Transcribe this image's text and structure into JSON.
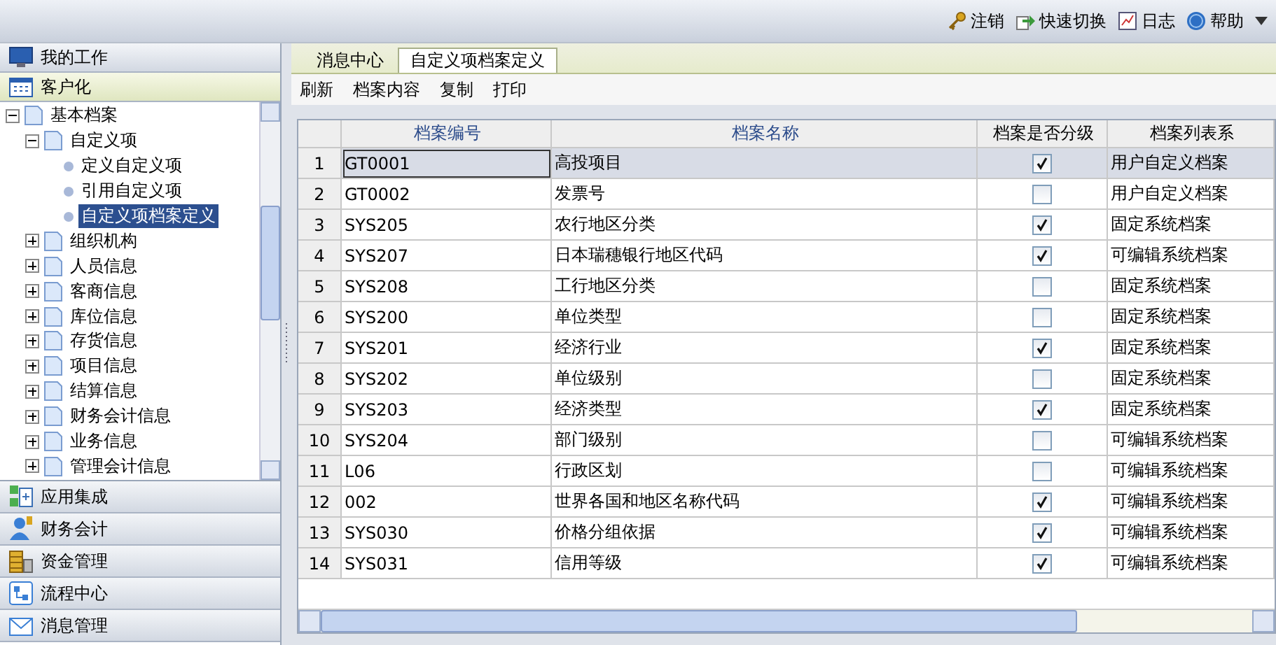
{
  "top_bar": {
    "actions": [
      {
        "label": "注销"
      },
      {
        "label": "快速切换"
      },
      {
        "label": "日志"
      },
      {
        "label": "帮助"
      }
    ]
  },
  "sections": [
    {
      "label": "我的工作",
      "selected": false
    },
    {
      "label": "客户化",
      "selected": true
    },
    {
      "label": "应用集成",
      "selected": false
    },
    {
      "label": "财务会计",
      "selected": false
    },
    {
      "label": "资金管理",
      "selected": false
    },
    {
      "label": "流程中心",
      "selected": false
    },
    {
      "label": "消息管理",
      "selected": false
    }
  ],
  "tree": [
    {
      "label": "基本档案",
      "kind": "folder",
      "expanded": true,
      "selected": false,
      "children": [
        {
          "label": "自定义项",
          "kind": "folder",
          "expanded": true,
          "selected": false,
          "children": [
            {
              "label": "定义自定义项",
              "kind": "leaf",
              "selected": false
            },
            {
              "label": "引用自定义项",
              "kind": "leaf",
              "selected": false
            },
            {
              "label": "自定义项档案定义",
              "kind": "leaf",
              "selected": true
            }
          ]
        },
        {
          "label": "组织机构",
          "kind": "folder",
          "expanded": false,
          "selected": false
        },
        {
          "label": "人员信息",
          "kind": "folder",
          "expanded": false,
          "selected": false
        },
        {
          "label": "客商信息",
          "kind": "folder",
          "expanded": false,
          "selected": false
        },
        {
          "label": "库位信息",
          "kind": "folder",
          "expanded": false,
          "selected": false
        },
        {
          "label": "存货信息",
          "kind": "folder",
          "expanded": false,
          "selected": false
        },
        {
          "label": "项目信息",
          "kind": "folder",
          "expanded": false,
          "selected": false
        },
        {
          "label": "结算信息",
          "kind": "folder",
          "expanded": false,
          "selected": false
        },
        {
          "label": "财务会计信息",
          "kind": "folder",
          "expanded": false,
          "selected": false
        },
        {
          "label": "业务信息",
          "kind": "folder",
          "expanded": false,
          "selected": false
        },
        {
          "label": "管理会计信息",
          "kind": "folder",
          "expanded": false,
          "selected": false
        }
      ]
    }
  ],
  "tabs": [
    {
      "label": "消息中心",
      "selected": false
    },
    {
      "label": "自定义项档案定义",
      "selected": true
    }
  ],
  "toolbar": [
    "刷新",
    "档案内容",
    "复制",
    "打印"
  ],
  "table": {
    "columns": [
      "档案编号",
      "档案名称",
      "档案是否分级",
      "档案列表系"
    ],
    "rows": [
      {
        "index": "1",
        "code": "GT0001",
        "name": "高投项目",
        "graded": true,
        "list_type": "用户自定义档案",
        "selected": true
      },
      {
        "index": "2",
        "code": "GT0002",
        "name": "发票号",
        "graded": false,
        "list_type": "用户自定义档案",
        "selected": false
      },
      {
        "index": "3",
        "code": "SYS205",
        "name": "农行地区分类",
        "graded": true,
        "list_type": "固定系统档案",
        "selected": false
      },
      {
        "index": "4",
        "code": "SYS207",
        "name": "日本瑞穗银行地区代码",
        "graded": true,
        "list_type": "可编辑系统档案",
        "selected": false
      },
      {
        "index": "5",
        "code": "SYS208",
        "name": "工行地区分类",
        "graded": false,
        "list_type": "固定系统档案",
        "selected": false
      },
      {
        "index": "6",
        "code": "SYS200",
        "name": "单位类型",
        "graded": false,
        "list_type": "固定系统档案",
        "selected": false
      },
      {
        "index": "7",
        "code": "SYS201",
        "name": "经济行业",
        "graded": true,
        "list_type": "固定系统档案",
        "selected": false
      },
      {
        "index": "8",
        "code": "SYS202",
        "name": "单位级别",
        "graded": false,
        "list_type": "固定系统档案",
        "selected": false
      },
      {
        "index": "9",
        "code": "SYS203",
        "name": "经济类型",
        "graded": true,
        "list_type": "固定系统档案",
        "selected": false
      },
      {
        "index": "10",
        "code": "SYS204",
        "name": "部门级别",
        "graded": false,
        "list_type": "可编辑系统档案",
        "selected": false
      },
      {
        "index": "11",
        "code": "L06",
        "name": "行政区划",
        "graded": false,
        "list_type": "可编辑系统档案",
        "selected": false
      },
      {
        "index": "12",
        "code": "002",
        "name": "世界各国和地区名称代码",
        "graded": true,
        "list_type": "可编辑系统档案",
        "selected": false
      },
      {
        "index": "13",
        "code": "SYS030",
        "name": "价格分组依据",
        "graded": true,
        "list_type": "可编辑系统档案",
        "selected": false
      },
      {
        "index": "14",
        "code": "SYS031",
        "name": "信用等级",
        "graded": true,
        "list_type": "可编辑系统档案",
        "selected": false
      }
    ]
  }
}
